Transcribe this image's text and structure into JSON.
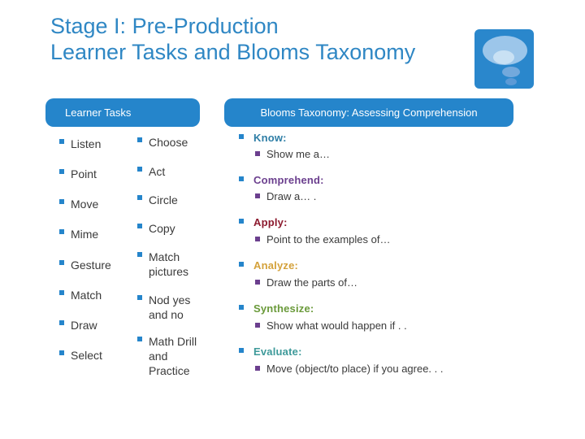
{
  "slide": {
    "title_line1": "Stage I: Pre-Production",
    "title_line2": "Learner Tasks and Blooms Taxonomy",
    "logo_icon": "thought-bubble-icon"
  },
  "headers": {
    "left": "Learner Tasks",
    "right": "Blooms Taxonomy: Assessing Comprehension"
  },
  "learner_tasks": {
    "column1": [
      "Listen",
      "Point",
      "Move",
      "Mime",
      "Gesture",
      "Match",
      "Draw",
      "Select"
    ],
    "column2": [
      "Choose",
      "Act",
      "Circle",
      "Copy",
      "Match pictures",
      "Nod yes and no",
      "Math Drill and Practice"
    ]
  },
  "blooms": [
    {
      "level": "Know:",
      "example": "Show me a…",
      "color": "#2e7ea6"
    },
    {
      "level": "Comprehend:",
      "example": "Draw a… .",
      "color": "#6b3f8e"
    },
    {
      "level": "Apply:",
      "example": "Point to the examples of…",
      "color": "#8c1a2e"
    },
    {
      "level": "Analyze:",
      "example": "Draw the parts of…",
      "color": "#d4a13a"
    },
    {
      "level": "Synthesize:",
      "example": "Show what would happen if . .",
      "color": "#6a9a3a"
    },
    {
      "level": "Evaluate:",
      "example": "Move (object/to place) if you agree. . .",
      "color": "#3e9a9a"
    }
  ],
  "colors": {
    "title": "#2f87c4",
    "header_fill": "#2585cb",
    "bullet_primary": "#2585cb",
    "bullet_secondary": "#6b3f8e"
  }
}
